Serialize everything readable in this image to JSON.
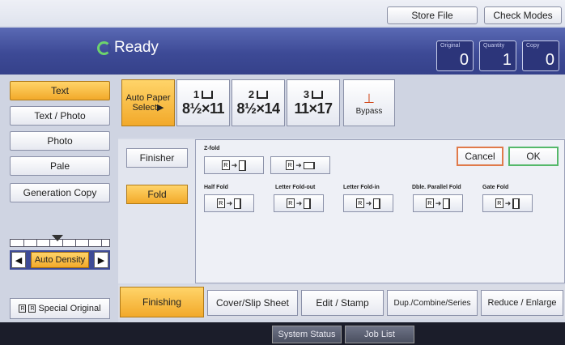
{
  "topbar": {
    "store_file": "Store File",
    "check_modes": "Check Modes"
  },
  "status": {
    "text": "Ready",
    "original_label": "Original",
    "original_value": "0",
    "quantity_label": "Quantity",
    "quantity_value": "1",
    "copy_label": "Copy",
    "copy_value": "0"
  },
  "original_types": [
    "Text",
    "Text / Photo",
    "Photo",
    "Pale",
    "Generation Copy"
  ],
  "density": {
    "label": "Auto Density",
    "left_arrow": "◀",
    "right_arrow": "▶"
  },
  "special_original": "Special Original",
  "paper": {
    "auto_line1": "Auto Paper",
    "auto_line2": "Select▶",
    "trays": [
      {
        "num": "1",
        "size": "8½×11"
      },
      {
        "num": "2",
        "size": "8½×14"
      },
      {
        "num": "3",
        "size": "11×17"
      }
    ],
    "bypass": "Bypass"
  },
  "finishing": {
    "finisher": "Finisher",
    "fold": "Fold",
    "zfold_label": "Z-fold",
    "half_fold": "Half Fold",
    "letter_fold_out": "Letter Fold-out",
    "letter_fold_in": "Letter Fold-in",
    "dble_parallel": "Dble. Parallel Fold",
    "gate_fold": "Gate Fold",
    "cancel": "Cancel",
    "ok": "OK"
  },
  "tabs": [
    "Finishing",
    "Cover/Slip Sheet",
    "Edit / Stamp",
    "Dup./Combine/Series",
    "Reduce / Enlarge"
  ],
  "bottom": {
    "system_status": "System Status",
    "job_list": "Job List"
  },
  "colors": {
    "accent_orange": "#f2a92a",
    "status_blue": "#3d4a96",
    "ok_green": "#55b86a",
    "cancel_orange": "#e07a4a"
  }
}
